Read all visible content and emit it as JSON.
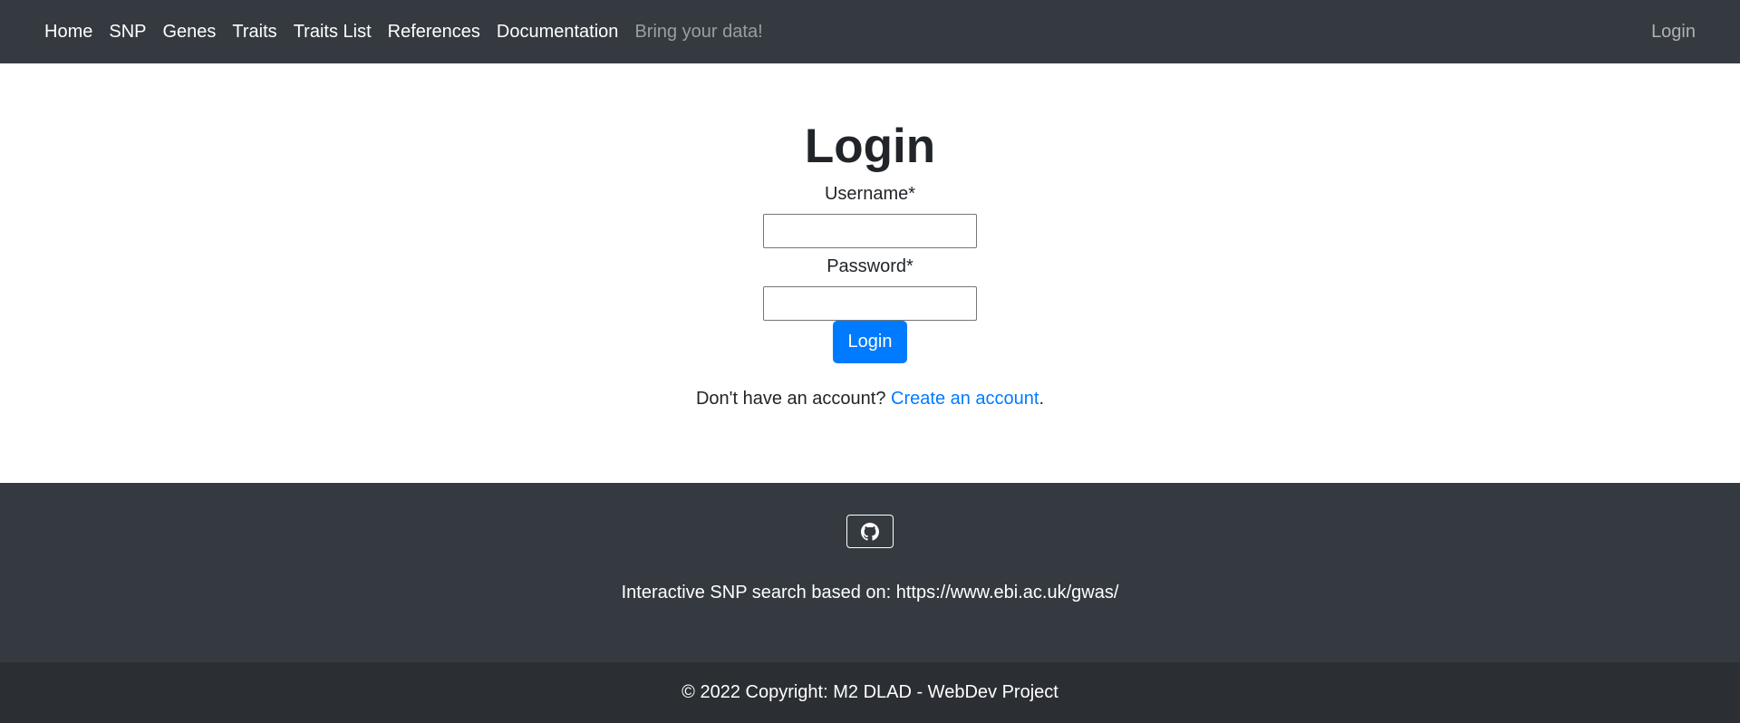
{
  "navbar": {
    "links": [
      "Home",
      "SNP",
      "Genes",
      "Traits",
      "Traits List",
      "References",
      "Documentation"
    ],
    "disabled_link": "Bring your data!",
    "login_link": "Login"
  },
  "login_form": {
    "title": "Login",
    "username_label": "Username*",
    "username_value": "",
    "password_label": "Password*",
    "password_value": "",
    "submit_label": "Login",
    "account_prompt": "Don't have an account?",
    "create_account_link": "Create an account",
    "account_suffix": "."
  },
  "footer": {
    "github_icon": "github-icon",
    "source_text": "Interactive SNP search based on: https://www.ebi.ac.uk/gwas/",
    "copyright": "© 2022 Copyright: M2 DLAD - WebDev Project"
  }
}
